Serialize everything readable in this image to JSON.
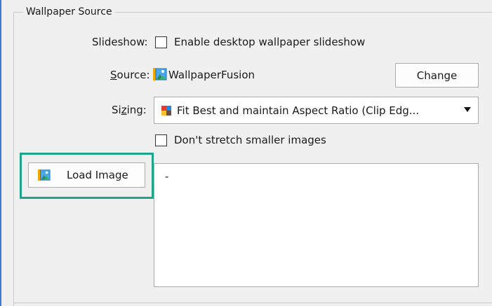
{
  "group": {
    "title": "Wallpaper Source"
  },
  "slideshow": {
    "label": "Slideshow:",
    "checkbox_label": "Enable desktop wallpaper slideshow",
    "checked": false
  },
  "source": {
    "label_prefix": "",
    "label_mnemonic": "S",
    "label_rest": "ource:",
    "icon": "image-icon",
    "value": "WallpaperFusion",
    "change_button": "Change"
  },
  "sizing": {
    "label_prefix": "Si",
    "label_mnemonic": "z",
    "label_rest": "ing:",
    "icon": "color-swatch-icon",
    "selected": "Fit Best and maintain Aspect Ratio (Clip Edg..."
  },
  "stretch": {
    "checkbox_label": "Don't stretch smaller images",
    "checked": false
  },
  "load": {
    "button_label": "Load Image",
    "icon": "image-icon"
  },
  "image_box": {
    "content": "-"
  },
  "colors": {
    "highlight": "#1fa58a",
    "window_bg": "#f0f0f0",
    "accent_edge": "#3a7bd5"
  }
}
